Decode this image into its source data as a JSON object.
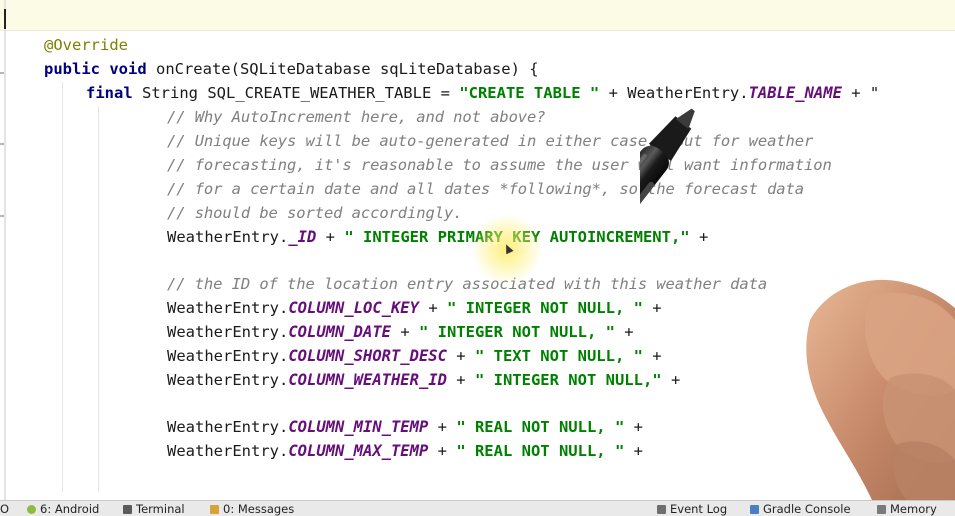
{
  "code_lines": [
    [
      {
        "t": "@Override",
        "c": "ann"
      }
    ],
    [
      {
        "t": "public void ",
        "c": "kw"
      },
      {
        "t": "onCreate(SQLiteDatabase sqLiteDatabase) {",
        "c": ""
      }
    ],
    [
      {
        "t": "final ",
        "c": "kw"
      },
      {
        "t": "String SQL_CREATE_WEATHER_TABLE = ",
        "c": ""
      },
      {
        "t": "\"CREATE TABLE \"",
        "c": "str"
      },
      {
        "t": " + WeatherEntry.",
        "c": ""
      },
      {
        "t": "TABLE_NAME",
        "c": "fld"
      },
      {
        "t": " + \"",
        "c": ""
      }
    ],
    [
      {
        "t": "// Why AutoIncrement here, and not above?",
        "c": "cmt"
      }
    ],
    [
      {
        "t": "// Unique keys will be auto-generated in either case.  But for weather",
        "c": "cmt"
      }
    ],
    [
      {
        "t": "// forecasting, it's reasonable to assume the user will want information",
        "c": "cmt"
      }
    ],
    [
      {
        "t": "// for a certain date and all dates *following*, so the forecast data",
        "c": "cmt"
      }
    ],
    [
      {
        "t": "// should be sorted accordingly.",
        "c": "cmt"
      }
    ],
    [
      {
        "t": "WeatherEntry.",
        "c": ""
      },
      {
        "t": "_ID",
        "c": "fld"
      },
      {
        "t": " + ",
        "c": ""
      },
      {
        "t": "\" INTEGER PRIMARY KEY AUTOINCREMENT,\"",
        "c": "str"
      },
      {
        "t": " +",
        "c": ""
      }
    ],
    [],
    [
      {
        "t": "// the ID of the location entry associated with this weather data",
        "c": "cmt"
      }
    ],
    [
      {
        "t": "WeatherEntry.",
        "c": ""
      },
      {
        "t": "COLUMN_LOC_KEY",
        "c": "fld"
      },
      {
        "t": " + ",
        "c": ""
      },
      {
        "t": "\" INTEGER NOT NULL, \"",
        "c": "str"
      },
      {
        "t": " +",
        "c": ""
      }
    ],
    [
      {
        "t": "WeatherEntry.",
        "c": ""
      },
      {
        "t": "COLUMN_DATE",
        "c": "fld"
      },
      {
        "t": " + ",
        "c": ""
      },
      {
        "t": "\" INTEGER NOT NULL, \"",
        "c": "str"
      },
      {
        "t": " +",
        "c": ""
      }
    ],
    [
      {
        "t": "WeatherEntry.",
        "c": ""
      },
      {
        "t": "COLUMN_SHORT_DESC",
        "c": "fld"
      },
      {
        "t": " + ",
        "c": ""
      },
      {
        "t": "\" TEXT NOT NULL, \"",
        "c": "str"
      },
      {
        "t": " +",
        "c": ""
      }
    ],
    [
      {
        "t": "WeatherEntry.",
        "c": ""
      },
      {
        "t": "COLUMN_WEATHER_ID",
        "c": "fld"
      },
      {
        "t": " + ",
        "c": ""
      },
      {
        "t": "\" INTEGER NOT NULL,\"",
        "c": "str"
      },
      {
        "t": " +",
        "c": ""
      }
    ],
    [],
    [
      {
        "t": "WeatherEntry.",
        "c": ""
      },
      {
        "t": "COLUMN_MIN_TEMP",
        "c": "fld"
      },
      {
        "t": " + ",
        "c": ""
      },
      {
        "t": "\" REAL NOT NULL, \"",
        "c": "str"
      },
      {
        "t": " +",
        "c": ""
      }
    ],
    [
      {
        "t": "WeatherEntry.",
        "c": ""
      },
      {
        "t": "COLUMN_MAX_TEMP",
        "c": "fld"
      },
      {
        "t": " + ",
        "c": ""
      },
      {
        "t": "\" REAL NOT NULL, \"",
        "c": "str"
      },
      {
        "t": " +",
        "c": ""
      }
    ]
  ],
  "status_bar": {
    "left_partial": "O",
    "android_tab": "6: Android",
    "terminal_tab": "Terminal",
    "messages_tab": "0: Messages",
    "event_log": "Event Log",
    "gradle_console": "Gradle Console",
    "memory_partial": "Memory"
  },
  "colors": {
    "keyword": "#000080",
    "annotation": "#808000",
    "string": "#008000",
    "field": "#660e7a",
    "comment": "#808080",
    "current_line_highlight": "#fbfbe6"
  },
  "icons": {
    "android": "android-icon",
    "terminal": "terminal-icon",
    "messages": "messages-icon",
    "event_log": "event-log-icon",
    "gradle": "gradle-icon",
    "memory": "memory-icon"
  }
}
